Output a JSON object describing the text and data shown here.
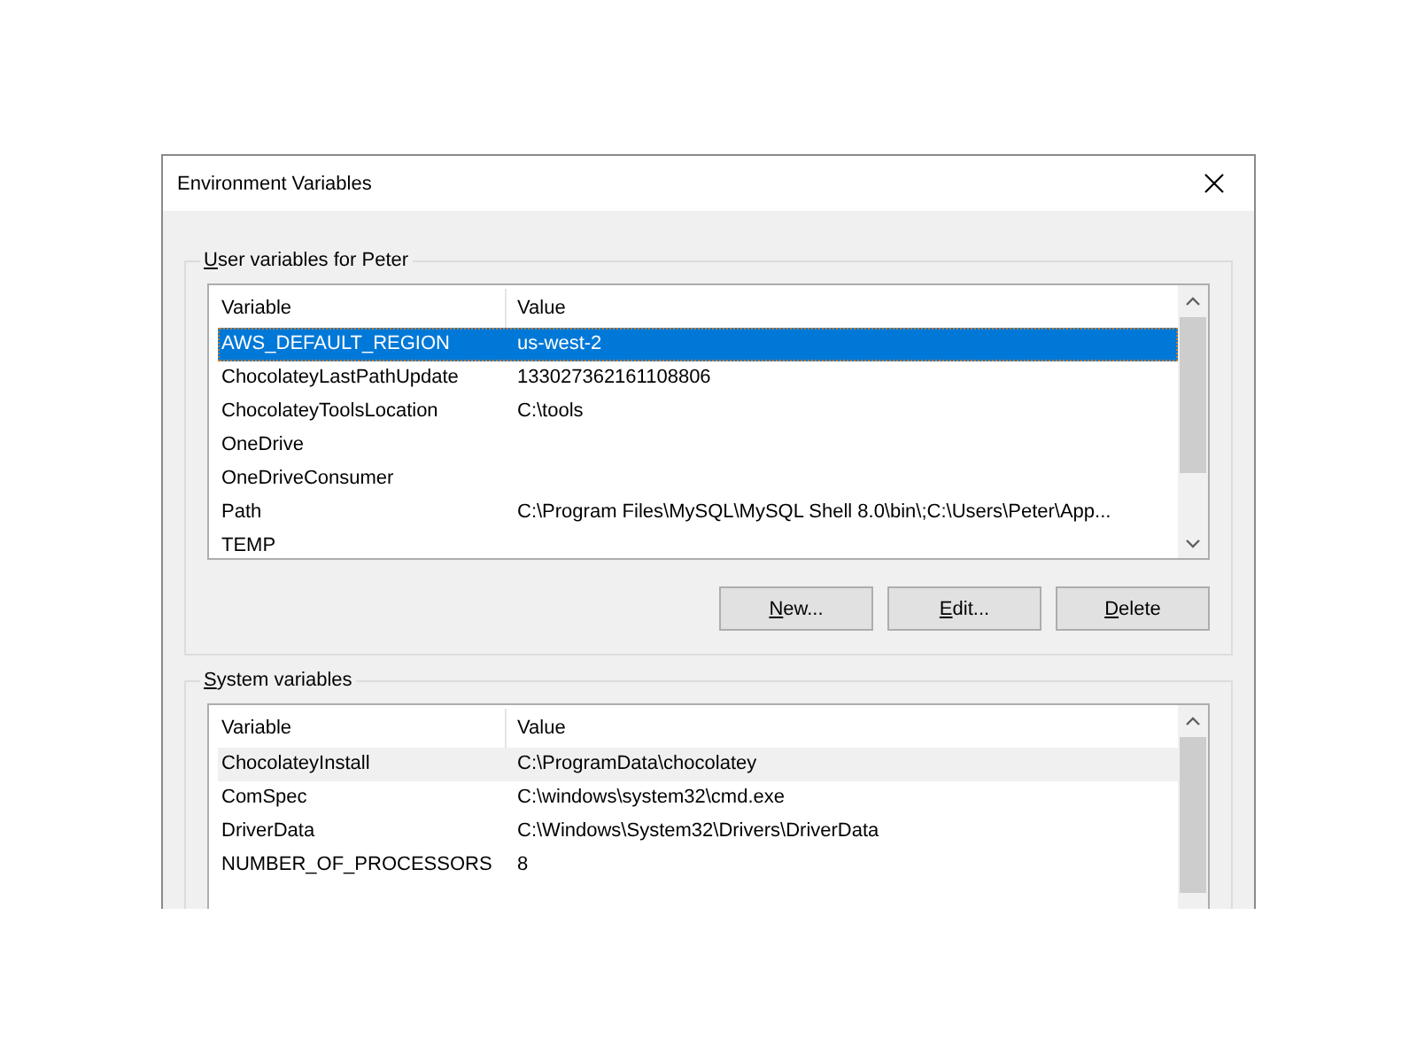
{
  "window": {
    "title": "Environment Variables"
  },
  "sections": [
    {
      "label": "User variables for Peter",
      "mnemonic": true,
      "focused": true,
      "columns": [
        "Variable",
        "Value"
      ],
      "rows": [
        {
          "variable": "AWS_DEFAULT_REGION",
          "value": "us-west-2",
          "selected": true
        },
        {
          "variable": "ChocolateyLastPathUpdate",
          "value": "133027362161108806",
          "selected": false
        },
        {
          "variable": "ChocolateyToolsLocation",
          "value": "C:\\tools",
          "selected": false
        },
        {
          "variable": "OneDrive",
          "selected": false
        },
        {
          "variable": "OneDriveConsumer",
          "selected": false
        },
        {
          "variable": "Path",
          "value": "C:\\Program Files\\MySQL\\MySQL Shell 8.0\\bin\\;C:\\Users\\Peter\\App...",
          "selected": false
        },
        {
          "variable": "TEMP",
          "selected": false
        }
      ],
      "buttons": [
        {
          "label": "New...",
          "mnemonic": true
        },
        {
          "label": "Edit...",
          "mnemonic": true
        },
        {
          "label": "Delete",
          "mnemonic": true
        }
      ]
    },
    {
      "label": "System variables",
      "mnemonic": true,
      "focused": false,
      "columns": [
        "Variable",
        "Value"
      ],
      "rows": [
        {
          "variable": "ChocolateyInstall",
          "value": "C:\\ProgramData\\chocolatey",
          "selected": true
        },
        {
          "variable": "ComSpec",
          "value": "C:\\windows\\system32\\cmd.exe",
          "selected": false
        },
        {
          "variable": "DriverData",
          "value": "C:\\Windows\\System32\\Drivers\\DriverData",
          "selected": false
        },
        {
          "variable": "NUMBER_OF_PROCESSORS",
          "value": "8",
          "selected": false
        }
      ]
    }
  ]
}
